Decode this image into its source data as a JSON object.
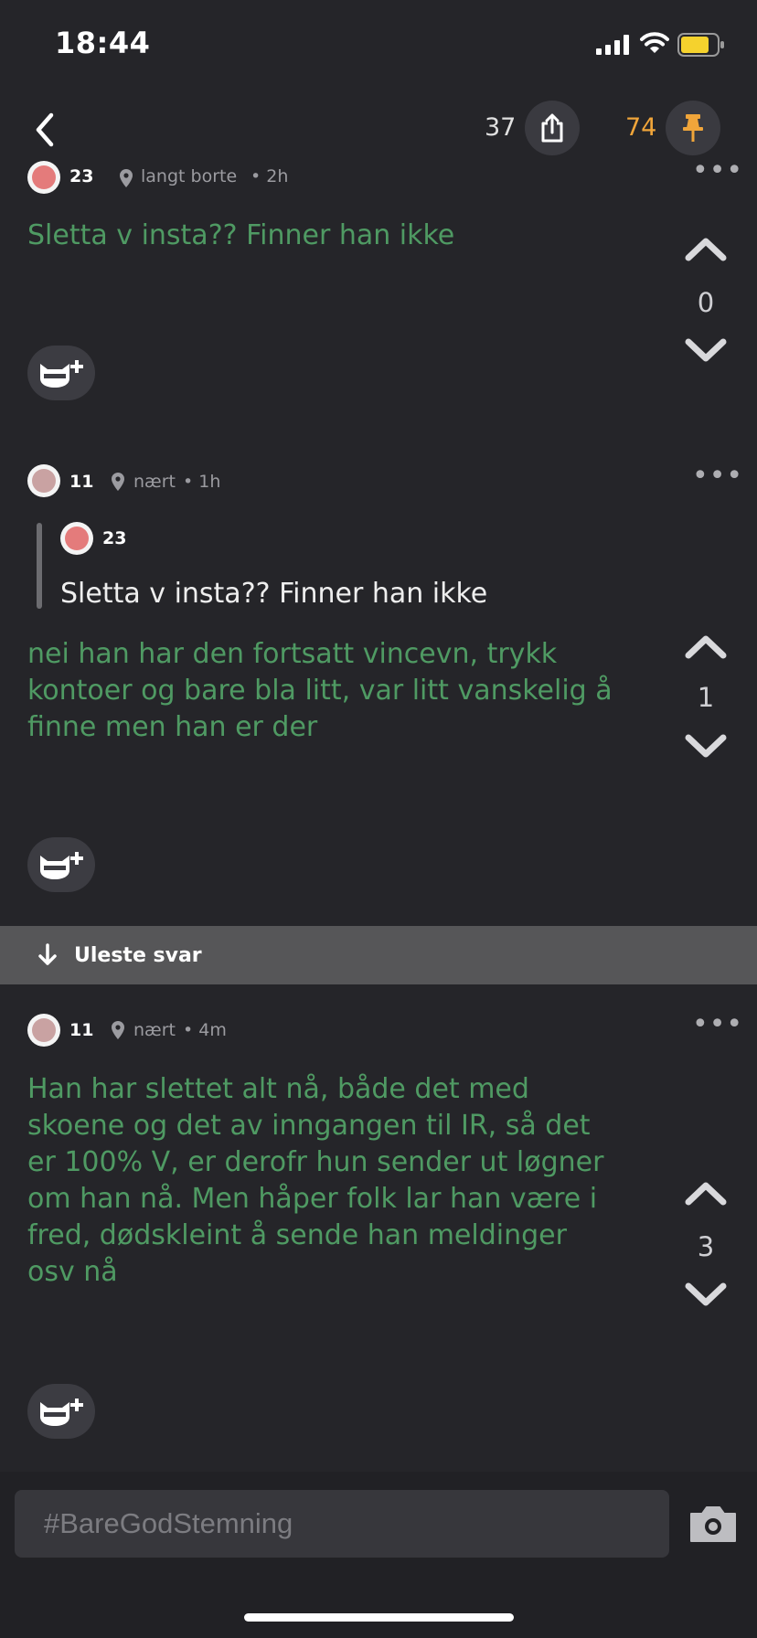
{
  "status_bar": {
    "time": "18:44",
    "battery_color": "#f5d22d"
  },
  "top_bar": {
    "share_count": "37",
    "pin_count": "74",
    "pin_color": "#f0a53a"
  },
  "posts": [
    {
      "user": "23",
      "location": "langt borte",
      "age": "• 2h",
      "text": "Sletta v insta?? Finner han ikke",
      "votes": "0"
    },
    {
      "user": "11",
      "location": "nært",
      "age": "• 1h",
      "quote_user": "23",
      "quote_text": "Sletta v insta?? Finner han ikke",
      "text": "nei han har den fortsatt vincevn, trykk kontoer og bare bla litt, var litt vanskelig å finne men han er der",
      "votes": "1"
    },
    {
      "user": "11",
      "location": "nært",
      "age": "• 4m",
      "text": "Han har slettet alt nå, både det med skoene og det av inngangen til IR, så det er 100% V, er derofr hun sender ut løgner om han nå. Men håper folk lar han være i fred, dødskleint å sende han meldinger osv nå",
      "votes": "3"
    }
  ],
  "unread": {
    "label": "Uleste svar"
  },
  "composer": {
    "placeholder": "#BareGodStemning"
  },
  "colors": {
    "post_text": "#4f9a63",
    "background": "#252529"
  }
}
